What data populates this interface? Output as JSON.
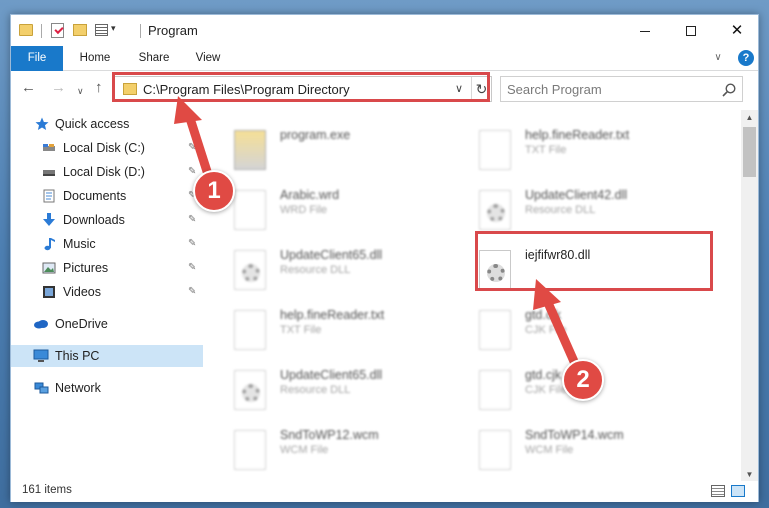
{
  "window": {
    "title": "Program",
    "quick_access_pin": "▾"
  },
  "ribbon": {
    "tabs": [
      "File",
      "Home",
      "Share",
      "View"
    ],
    "help": "?",
    "expand": "∨"
  },
  "address": {
    "path": "C:\\Program Files\\Program Directory",
    "back": "←",
    "forward": "→",
    "recent": "∨",
    "up": "↑",
    "dropdown": "∨",
    "refresh": "↻"
  },
  "search": {
    "placeholder": "Search Program"
  },
  "sidebar": {
    "items": [
      {
        "label": "Quick access",
        "icon": "star-icon"
      },
      {
        "label": "Local Disk (C:)",
        "icon": "drive-icon"
      },
      {
        "label": "Local Disk (D:)",
        "icon": "drive-icon"
      },
      {
        "label": "Documents",
        "icon": "documents-icon"
      },
      {
        "label": "Downloads",
        "icon": "download-icon"
      },
      {
        "label": "Music",
        "icon": "music-icon"
      },
      {
        "label": "Pictures",
        "icon": "pictures-icon"
      },
      {
        "label": "Videos",
        "icon": "videos-icon"
      },
      {
        "label": "OneDrive",
        "icon": "cloud-icon"
      },
      {
        "label": "This PC",
        "icon": "computer-icon"
      },
      {
        "label": "Network",
        "icon": "network-icon"
      }
    ],
    "pin_glyph": "📌"
  },
  "files": [
    {
      "name": "program.exe",
      "type": "",
      "kind": "exe",
      "col": 0,
      "row": 0
    },
    {
      "name": "help.fineReader.txt",
      "type": "TXT File",
      "kind": "doc",
      "col": 1,
      "row": 0
    },
    {
      "name": "Arabic.wrd",
      "type": "WRD File",
      "kind": "doc",
      "col": 0,
      "row": 1
    },
    {
      "name": "UpdateClient42.dll",
      "type": "Resource DLL",
      "kind": "dll",
      "col": 1,
      "row": 1
    },
    {
      "name": "UpdateClient65.dll",
      "type": "Resource DLL",
      "kind": "dll",
      "col": 0,
      "row": 2
    },
    {
      "name": "iejfifwr80.dll",
      "type": "",
      "kind": "dll",
      "col": 1,
      "row": 2,
      "highlight": true
    },
    {
      "name": "help.fineReader.txt",
      "type": "TXT File",
      "kind": "doc",
      "col": 0,
      "row": 3
    },
    {
      "name": "gtd.cjk",
      "type": "CJK File",
      "kind": "doc",
      "col": 1,
      "row": 3
    },
    {
      "name": "UpdateClient65.dll",
      "type": "Resource DLL",
      "kind": "dll",
      "col": 0,
      "row": 4
    },
    {
      "name": "gtd.cjk",
      "type": "CJK File",
      "kind": "doc",
      "col": 1,
      "row": 4
    },
    {
      "name": "SndToWP12.wcm",
      "type": "WCM File",
      "kind": "doc",
      "col": 0,
      "row": 5
    },
    {
      "name": "SndToWP14.wcm",
      "type": "WCM File",
      "kind": "doc",
      "col": 1,
      "row": 5
    }
  ],
  "status": {
    "item_count": "161 items"
  },
  "callouts": {
    "step1": "1",
    "step2": "2",
    "accent": "#d9494b"
  }
}
